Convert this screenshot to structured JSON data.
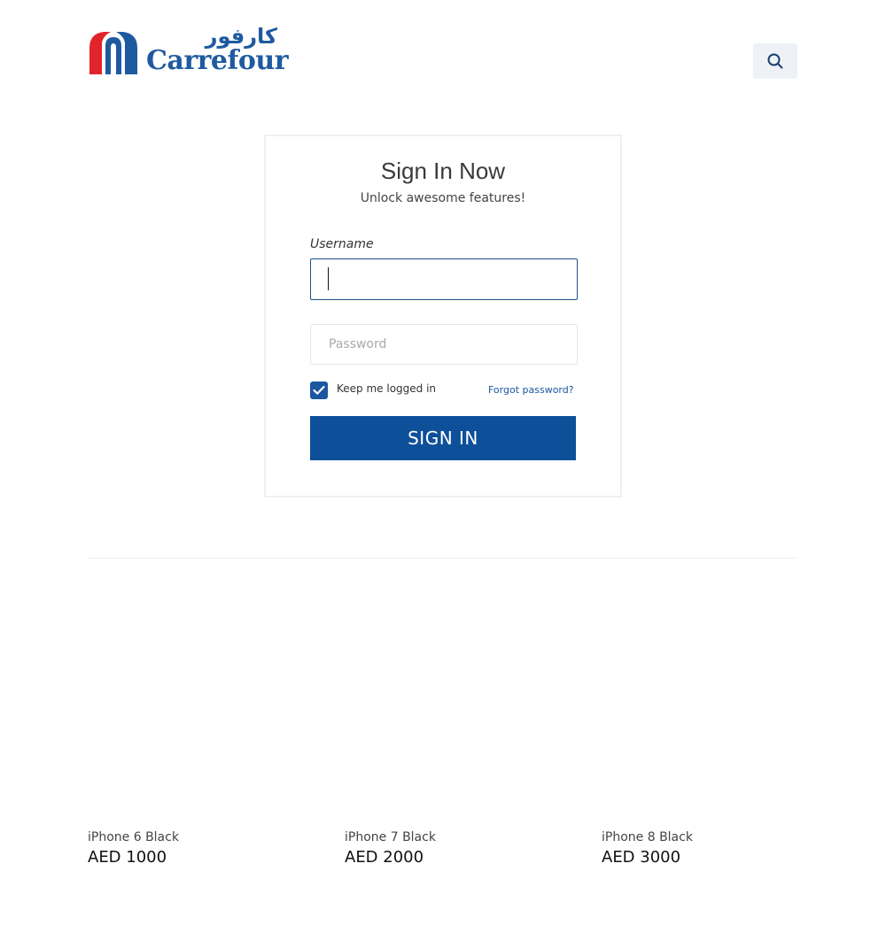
{
  "header": {
    "logo": {
      "arabic_text": "كارفور",
      "english_text": "Carrefour",
      "colors": {
        "blue": "#1f5aa0",
        "red": "#e3232c"
      }
    },
    "search_icon": "search-icon"
  },
  "signin": {
    "title": "Sign In Now",
    "subtitle": "Unlock awesome features!",
    "username_label": "Username",
    "username_value": "",
    "password_placeholder": "Password",
    "keep_logged_in_label": "Keep me logged in",
    "keep_logged_in_checked": true,
    "forgot_password": "Forgot password?",
    "submit_label": "SIGN IN"
  },
  "products": [
    {
      "name": "iPhone 6 Black",
      "price": "AED 1000"
    },
    {
      "name": "iPhone 7 Black",
      "price": "AED 2000"
    },
    {
      "name": "iPhone 8 Black",
      "price": "AED 3000"
    }
  ],
  "colors": {
    "primary": "#0e4f9a",
    "input_focus": "#1b4f8a",
    "search_bg": "#eef2f7"
  }
}
